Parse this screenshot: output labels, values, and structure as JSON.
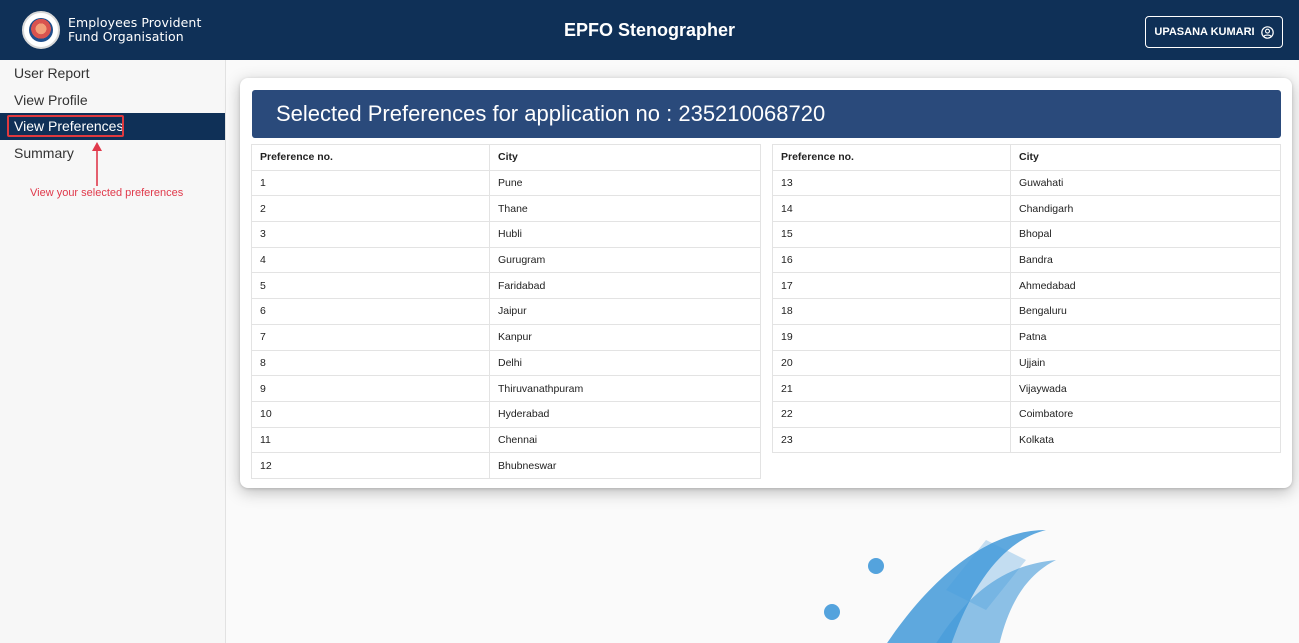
{
  "header": {
    "org_line1": "Employees Provident",
    "org_line2": "Fund Organisation",
    "title": "EPFO Stenographer",
    "user_name": "UPASANA KUMARI"
  },
  "sidebar": {
    "items": [
      {
        "label": "User Report"
      },
      {
        "label": "View Profile"
      },
      {
        "label": "View Preferences"
      },
      {
        "label": "Summary"
      }
    ],
    "hint": "View your selected preferences"
  },
  "main": {
    "heading": "Selected Preferences for application no : 235210068720",
    "columns": [
      "Preference no.",
      "City"
    ],
    "left_rows": [
      [
        "1",
        "Pune"
      ],
      [
        "2",
        "Thane"
      ],
      [
        "3",
        "Hubli"
      ],
      [
        "4",
        "Gurugram"
      ],
      [
        "5",
        "Faridabad"
      ],
      [
        "6",
        "Jaipur"
      ],
      [
        "7",
        "Kanpur"
      ],
      [
        "8",
        "Delhi"
      ],
      [
        "9",
        "Thiruvanathpuram"
      ],
      [
        "10",
        "Hyderabad"
      ],
      [
        "11",
        "Chennai"
      ],
      [
        "12",
        "Bhubneswar"
      ]
    ],
    "right_rows": [
      [
        "13",
        "Guwahati"
      ],
      [
        "14",
        "Chandigarh"
      ],
      [
        "15",
        "Bhopal"
      ],
      [
        "16",
        "Bandra"
      ],
      [
        "17",
        "Ahmedabad"
      ],
      [
        "18",
        "Bengaluru"
      ],
      [
        "19",
        "Patna"
      ],
      [
        "20",
        "Ujjain"
      ],
      [
        "21",
        "Vijaywada"
      ],
      [
        "22",
        "Coimbatore"
      ],
      [
        "23",
        "Kolkata"
      ]
    ]
  },
  "colors": {
    "header_bg": "#0f3057",
    "card_header_bg": "#2a4a7b",
    "hint_red": "#e0394b",
    "watermark_blue": "#2f8fd6"
  }
}
